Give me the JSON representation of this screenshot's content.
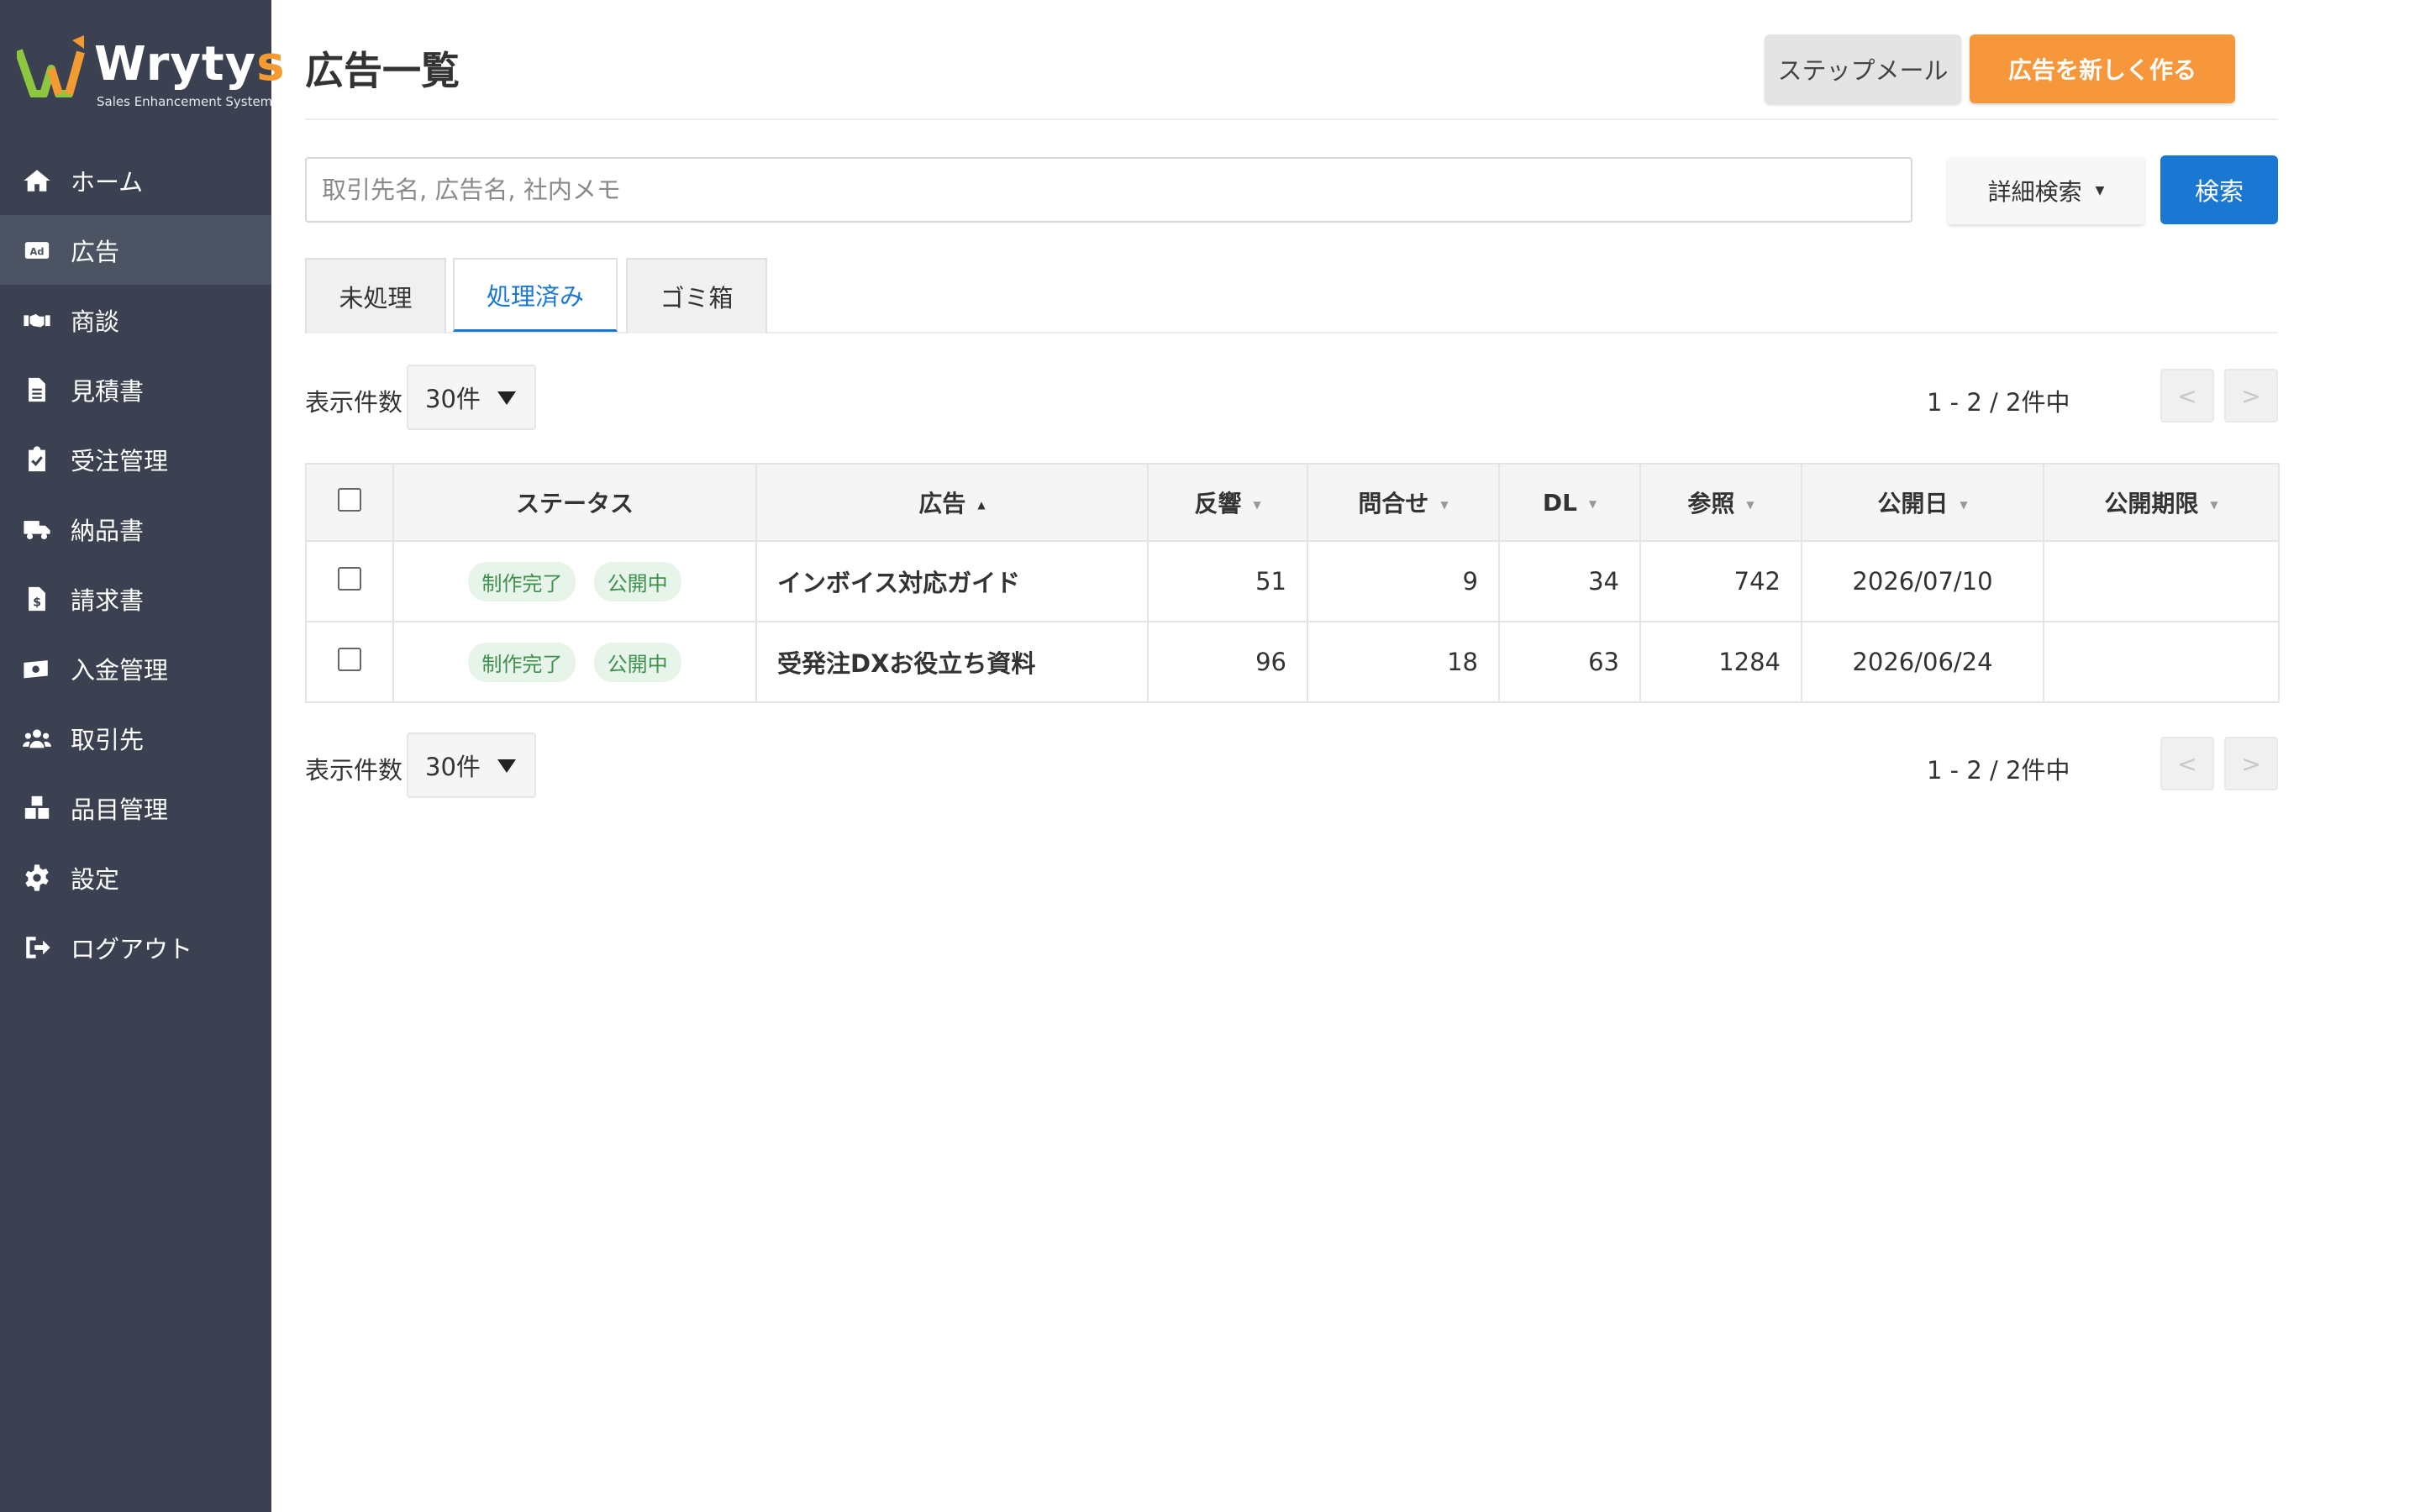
{
  "brand": {
    "name_main": "Wryty",
    "name_accent": "s",
    "subtitle": "Sales Enhancement System",
    "accent_color": "#f39a32",
    "sidebar_color": "#3b4150"
  },
  "sidebar": {
    "items": [
      {
        "label": "ホーム",
        "icon": "home-icon"
      },
      {
        "label": "広告",
        "icon": "ad-icon"
      },
      {
        "label": "商談",
        "icon": "handshake-icon"
      },
      {
        "label": "見積書",
        "icon": "document-icon"
      },
      {
        "label": "受注管理",
        "icon": "clipboard-check-icon"
      },
      {
        "label": "納品書",
        "icon": "truck-icon"
      },
      {
        "label": "請求書",
        "icon": "invoice-icon"
      },
      {
        "label": "入金管理",
        "icon": "money-icon"
      },
      {
        "label": "取引先",
        "icon": "users-icon"
      },
      {
        "label": "品目管理",
        "icon": "boxes-icon"
      },
      {
        "label": "設定",
        "icon": "gear-icon"
      },
      {
        "label": "ログアウト",
        "icon": "logout-icon"
      }
    ],
    "active_index": 1
  },
  "header": {
    "title": "広告一覧",
    "step_mail_label": "ステップメール",
    "new_ad_label": "広告を新しく作る"
  },
  "search": {
    "placeholder": "取引先名, 広告名, 社内メモ",
    "value": "",
    "detail_label": "詳細検索",
    "search_label": "検索"
  },
  "tabs": [
    {
      "label": "未処理",
      "active": false
    },
    {
      "label": "処理済み",
      "active": true
    },
    {
      "label": "ゴミ箱",
      "active": false
    }
  ],
  "pager": {
    "per_page_label": "表示件数",
    "per_page_value": "30件",
    "count_text": "1 - 2 / 2件中",
    "prev": "<",
    "next": ">"
  },
  "table": {
    "columns": {
      "status": "ステータス",
      "ad": "広告",
      "response": "反響",
      "inquiry": "問合せ",
      "dl": "DL",
      "views": "参照",
      "published": "公開日",
      "deadline": "公開期限"
    },
    "rows": [
      {
        "badges": [
          "制作完了",
          "公開中"
        ],
        "name": "インボイス対応ガイド",
        "response": "51",
        "inquiry": "9",
        "dl": "34",
        "views": "742",
        "published": "2026/07/10",
        "deadline": ""
      },
      {
        "badges": [
          "制作完了",
          "公開中"
        ],
        "name": "受発注DXお役立ち資料",
        "response": "96",
        "inquiry": "18",
        "dl": "63",
        "views": "1284",
        "published": "2026/06/24",
        "deadline": ""
      }
    ]
  }
}
